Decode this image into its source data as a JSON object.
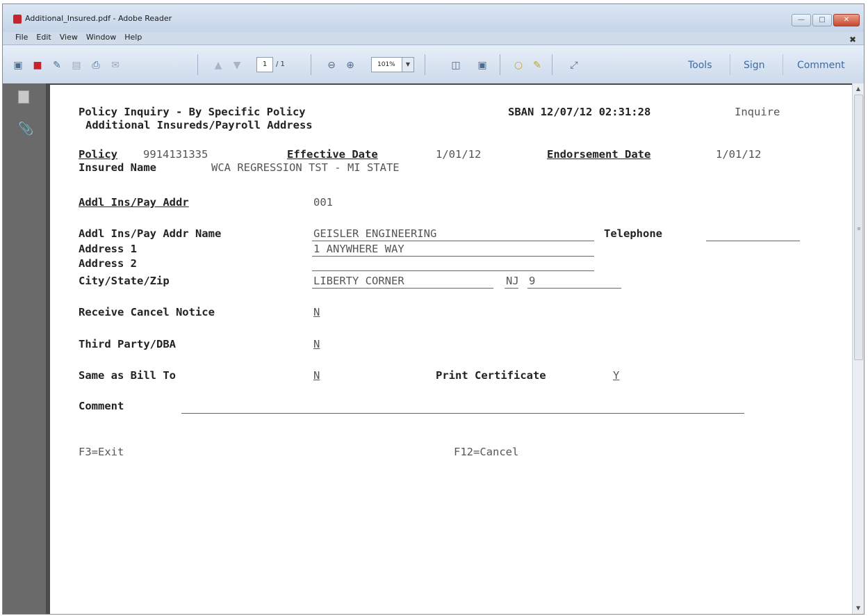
{
  "window": {
    "title": "Additional_Insured.pdf - Adobe Reader",
    "menu": [
      "File",
      "Edit",
      "View",
      "Window",
      "Help"
    ]
  },
  "toolbar": {
    "page_current": "1",
    "page_total": "/ 1",
    "zoom": "101%",
    "tools_label": "Tools",
    "sign_label": "Sign",
    "comment_label": "Comment"
  },
  "form": {
    "title": "Policy Inquiry - By Specific Policy",
    "subtitle": "Additional Insureds/Payroll Address",
    "header_info": "SBAN 12/07/12 02:31:28",
    "mode": "Inquire",
    "policy_label": "Policy",
    "policy_value": "9914131335",
    "effective_label": "Effective Date",
    "effective_value": "1/01/12",
    "endorsement_label": "Endorsement Date",
    "endorsement_value": "1/01/12",
    "insured_label": "Insured Name",
    "insured_value": "WCA REGRESSION TST - MI STATE",
    "addl_label": "Addl Ins/Pay Addr",
    "addl_value": "001",
    "addl_name_label": "Addl Ins/Pay Addr Name",
    "addl_name_value": "GEISLER ENGINEERING",
    "telephone_label": "Telephone",
    "telephone_value": "",
    "address1_label": "Address 1",
    "address1_value": "1 ANYWHERE WAY",
    "address2_label": "Address 2",
    "address2_value": "",
    "city_label": "City/State/Zip",
    "city_value": "LIBERTY CORNER",
    "state_value": "NJ",
    "zip_value": "9",
    "cancel_label": "Receive Cancel Notice",
    "cancel_value": "N",
    "third_label": "Third Party/DBA",
    "third_value": "N",
    "same_label": "Same as Bill To",
    "same_value": "N",
    "print_label": "Print Certificate",
    "print_value": "Y",
    "comment_label": "Comment",
    "f3": "F3=Exit",
    "f12": "F12=Cancel"
  }
}
